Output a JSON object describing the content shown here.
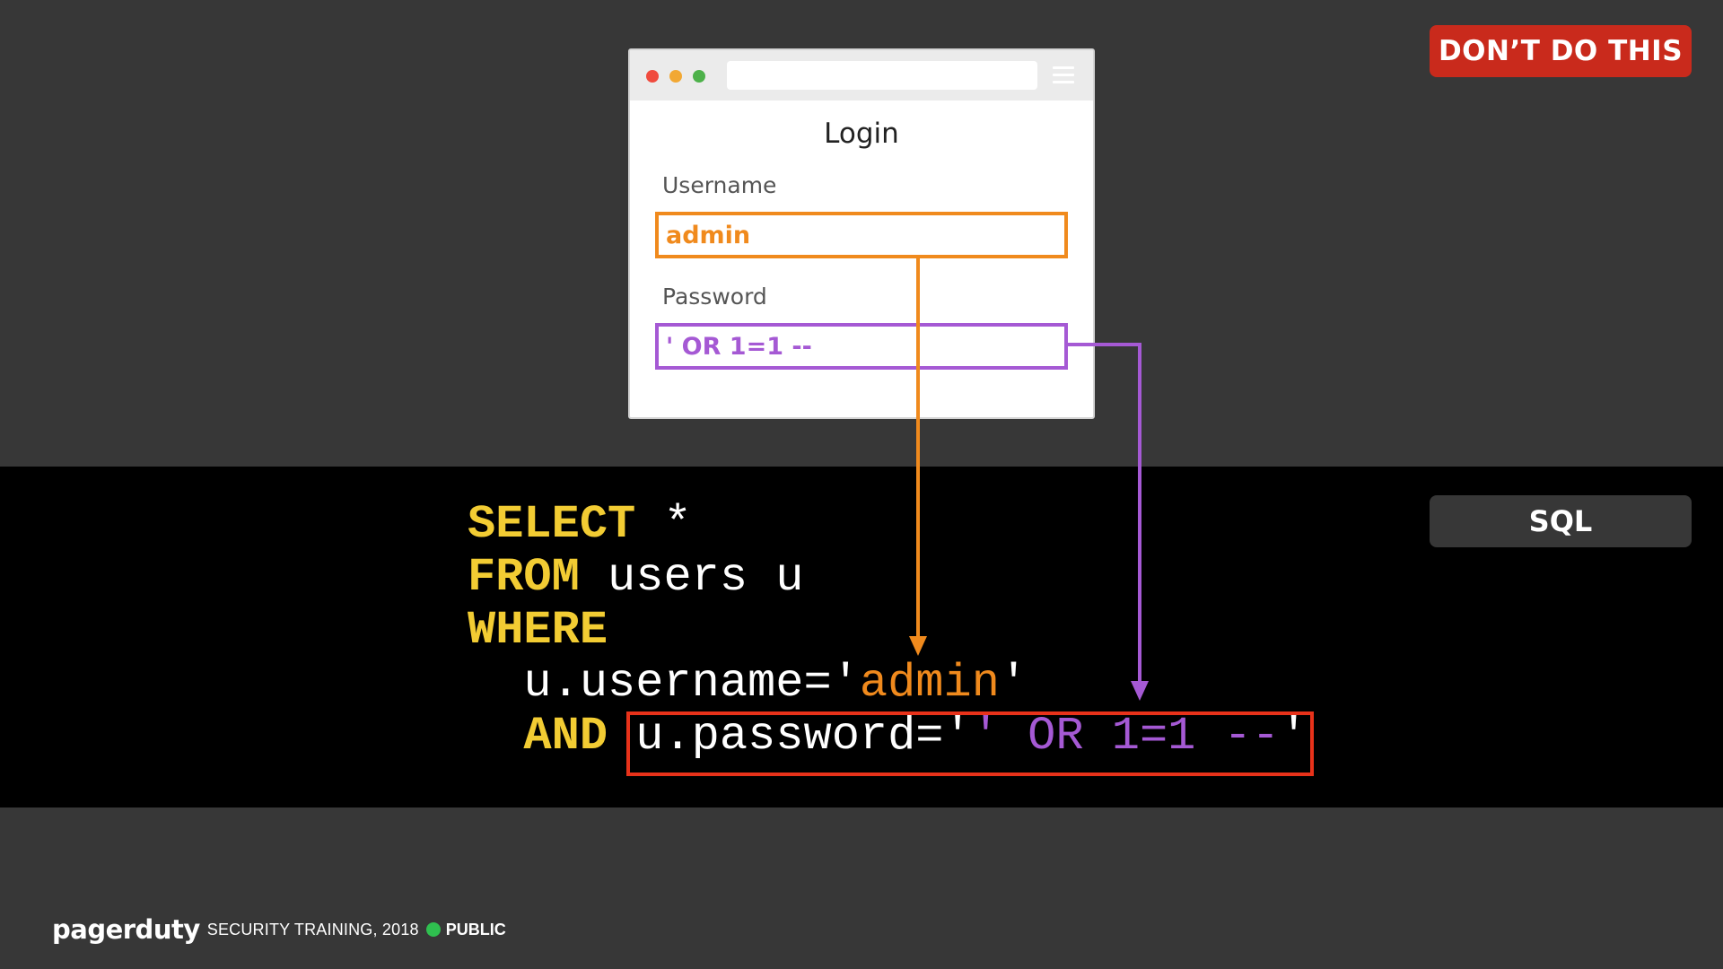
{
  "badges": {
    "warning": "DON’T DO THIS",
    "language": "SQL"
  },
  "login_form": {
    "title": "Login",
    "username_label": "Username",
    "username_value": "admin",
    "password_label": "Password",
    "password_value": "' OR 1=1 --"
  },
  "sql": {
    "select_kw": "SELECT",
    "select_rest": " *",
    "from_kw": "FROM",
    "from_rest": " users u",
    "where_kw": "WHERE",
    "username_prefix": "  u.username='",
    "username_value": "admin",
    "username_suffix": "'",
    "and_kw": "AND",
    "password_prefix": " u.password='",
    "password_value": "' OR 1=1 --",
    "password_suffix": "'"
  },
  "footer": {
    "logo": "pagerduty",
    "text": "SECURITY TRAINING, 2018",
    "status": "PUBLIC"
  },
  "colors": {
    "background": "#373737",
    "band": "#000000",
    "warning": "#c92a1c",
    "keyword": "#f2cc33",
    "username_highlight": "#f08a1d",
    "password_highlight": "#a559d4",
    "injection_box": "#e8321a",
    "public_status": "#2fbf4f"
  }
}
